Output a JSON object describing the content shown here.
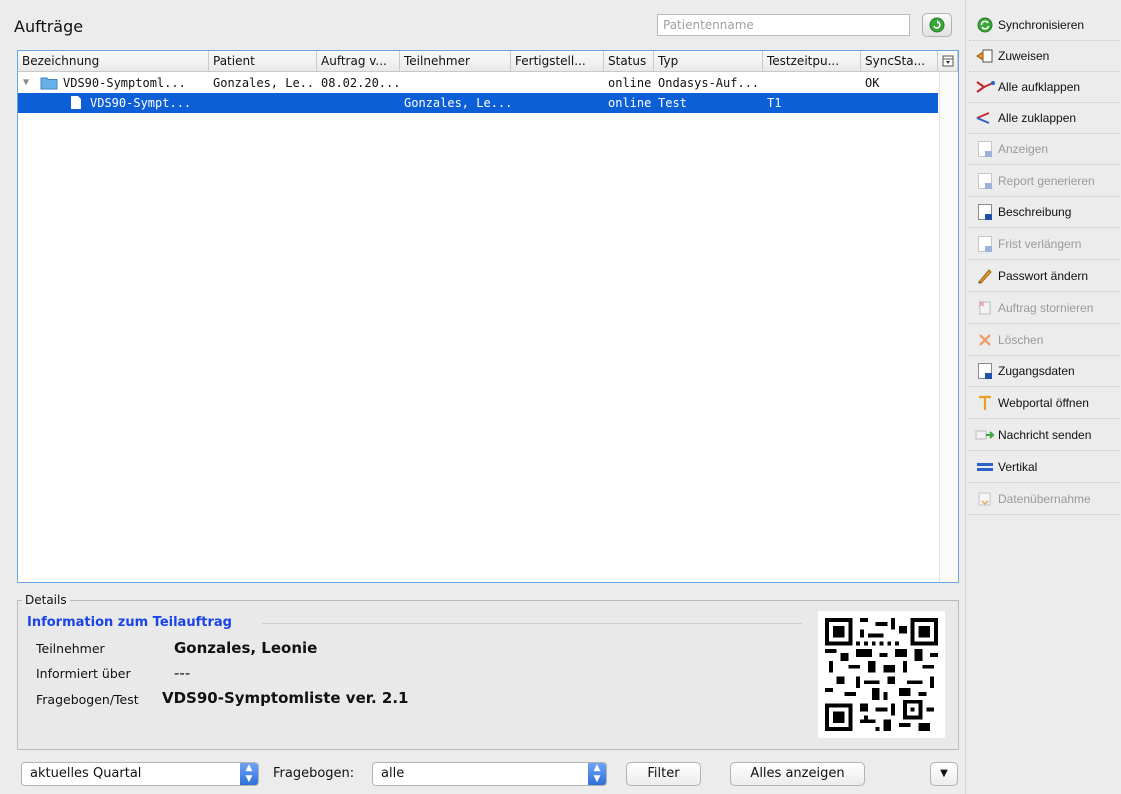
{
  "header": {
    "title": "Aufträge",
    "search_placeholder": "Patientenname"
  },
  "table": {
    "columns": [
      "Bezeichnung",
      "Patient",
      "Auftrag v...",
      "Teilnehmer",
      "Fertigstell...",
      "Status",
      "Typ",
      "Testzeitpu...",
      "SyncSta..."
    ],
    "rows": [
      {
        "bezeichnung": "VDS90-Symptoml...",
        "patient": "Gonzales, Le...",
        "auftrag": "08.02.20...",
        "teilnehmer": "",
        "fertig": "",
        "status": "online",
        "typ": "Ondasys-Auf...",
        "testzeit": "",
        "sync": "OK"
      },
      {
        "bezeichnung": "VDS90-Sympt...",
        "patient": "",
        "auftrag": "",
        "teilnehmer": "Gonzales, Le...",
        "fertig": "",
        "status": "online",
        "typ": "Test",
        "testzeit": "T1",
        "sync": ""
      }
    ]
  },
  "details": {
    "legend": "Details",
    "section_title": "Information zum Teilauftrag",
    "fields": [
      {
        "label": "Teilnehmer",
        "value": "Gonzales, Leonie"
      },
      {
        "label": "Informiert über",
        "value": "---"
      },
      {
        "label": "Fragebogen/Test",
        "value": "VDS90-Symptomliste ver. 2.1"
      }
    ]
  },
  "bottom": {
    "period_value": "aktuelles Quartal",
    "fragebogen_label": "Fragebogen:",
    "fragebogen_value": "alle",
    "filter_label": "Filter",
    "show_all_label": "Alles anzeigen"
  },
  "sidebar": {
    "items": [
      {
        "label": "Synchronisieren",
        "icon": "sync-icon",
        "enabled": true
      },
      {
        "label": "Zuweisen",
        "icon": "assign-icon",
        "enabled": true
      },
      {
        "label": "Alle aufklappen",
        "icon": "expand-all-icon",
        "enabled": true
      },
      {
        "label": "Alle zuklappen",
        "icon": "collapse-all-icon",
        "enabled": true
      },
      {
        "label": "Anzeigen",
        "icon": "view-document-icon",
        "enabled": false
      },
      {
        "label": "Report generieren",
        "icon": "report-document-icon",
        "enabled": false
      },
      {
        "label": "Beschreibung",
        "icon": "description-document-icon",
        "enabled": true
      },
      {
        "label": "Frist verlängern",
        "icon": "extend-deadline-icon",
        "enabled": false
      },
      {
        "label": "Passwort ändern",
        "icon": "pencil-icon",
        "enabled": true
      },
      {
        "label": "Auftrag stornieren",
        "icon": "cancel-order-icon",
        "enabled": false
      },
      {
        "label": "Löschen",
        "icon": "delete-x-icon",
        "enabled": false
      },
      {
        "label": "Zugangsdaten",
        "icon": "credentials-document-icon",
        "enabled": true
      },
      {
        "label": "Webportal öffnen",
        "icon": "webportal-icon",
        "enabled": true
      },
      {
        "label": "Nachricht senden",
        "icon": "send-message-icon",
        "enabled": true
      },
      {
        "label": "Vertikal",
        "icon": "vertical-layout-icon",
        "enabled": true
      },
      {
        "label": "Datenübernahme",
        "icon": "data-import-icon",
        "enabled": false
      }
    ]
  },
  "colors": {
    "selection": "#0d5fd8",
    "link_blue": "#1a44e8",
    "sync_green": "#3aa83a"
  }
}
